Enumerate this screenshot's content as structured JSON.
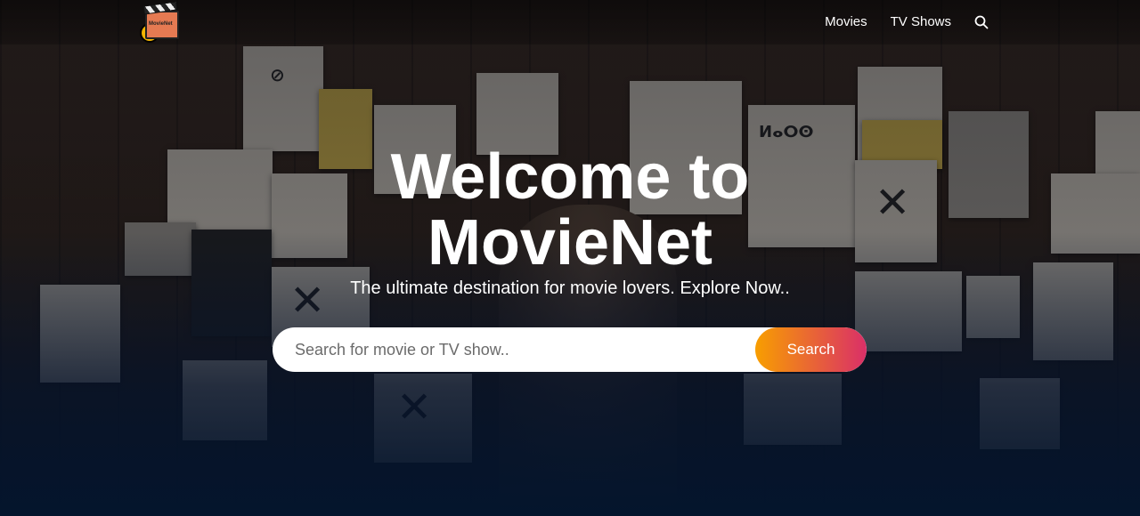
{
  "header": {
    "logo_alt": "MovieNet",
    "nav": [
      {
        "label": "Movies"
      },
      {
        "label": "TV Shows"
      }
    ]
  },
  "hero": {
    "title_line1": "Welcome to",
    "title_line2": "MovieNet",
    "subtitle": "The ultimate destination for movie lovers. Explore Now.."
  },
  "search": {
    "placeholder": "Search for movie or TV show..",
    "button_label": "Search"
  },
  "colors": {
    "accent_start": "#f89e00",
    "accent_end": "#da2f68",
    "background": "#04152d"
  },
  "icons": {
    "nav_search": "search-icon"
  }
}
